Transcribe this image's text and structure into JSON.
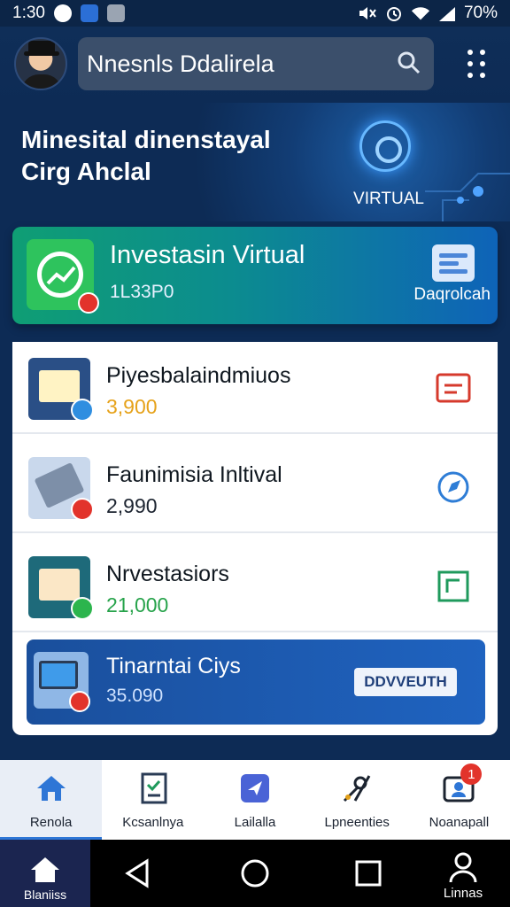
{
  "status_bar": {
    "time": "1:30",
    "battery": "70%"
  },
  "app_bar": {
    "search_text": "Nnesnls Ddalirela"
  },
  "hero": {
    "title_line1": "Minesital dinenstayal",
    "title_line2": "Cirg Ahclal",
    "badge_label": "VIRTUAL"
  },
  "invest_card": {
    "title": "Investasin Virtual",
    "amount": "1L33P0",
    "link_label": "Daqrolcah"
  },
  "list_items": [
    {
      "title": "Piyesbalaindmiuos",
      "value": "3,900",
      "value_color": "#e6a21a",
      "badge_color": "#2f8ee0",
      "action_color": "#d63a2c"
    },
    {
      "title": "Faunimisia Inltival",
      "value": "2,990",
      "value_color": "#1c2430",
      "badge_color": "#e2332b",
      "action_color": "#2e7dd6"
    },
    {
      "title": "Nrvestasiors",
      "value": "21,000",
      "value_color": "#27a34b",
      "badge_color": "#2cb54d",
      "action_color": "#1f9a5c"
    }
  ],
  "featured_item": {
    "title": "Tinarntai Ciys",
    "value": "35.090",
    "button_label": "DDVVEUTH"
  },
  "bottom_nav": [
    {
      "label": "Renola",
      "icon": "home-icon",
      "active": true
    },
    {
      "label": "Kcsanlnya",
      "icon": "document-icon",
      "active": false
    },
    {
      "label": "Lailalla",
      "icon": "send-icon",
      "active": false
    },
    {
      "label": "Lpneenties",
      "icon": "tools-icon",
      "active": false
    },
    {
      "label": "Noanapall",
      "icon": "profile-card-icon",
      "active": false,
      "badge": "1"
    }
  ],
  "system_bar": {
    "home_label": "Blaniiss",
    "user_label": "Linnas"
  },
  "colors": {
    "background": "#0d2b55",
    "accent": "#2e76d6",
    "alert": "#e2332b"
  }
}
